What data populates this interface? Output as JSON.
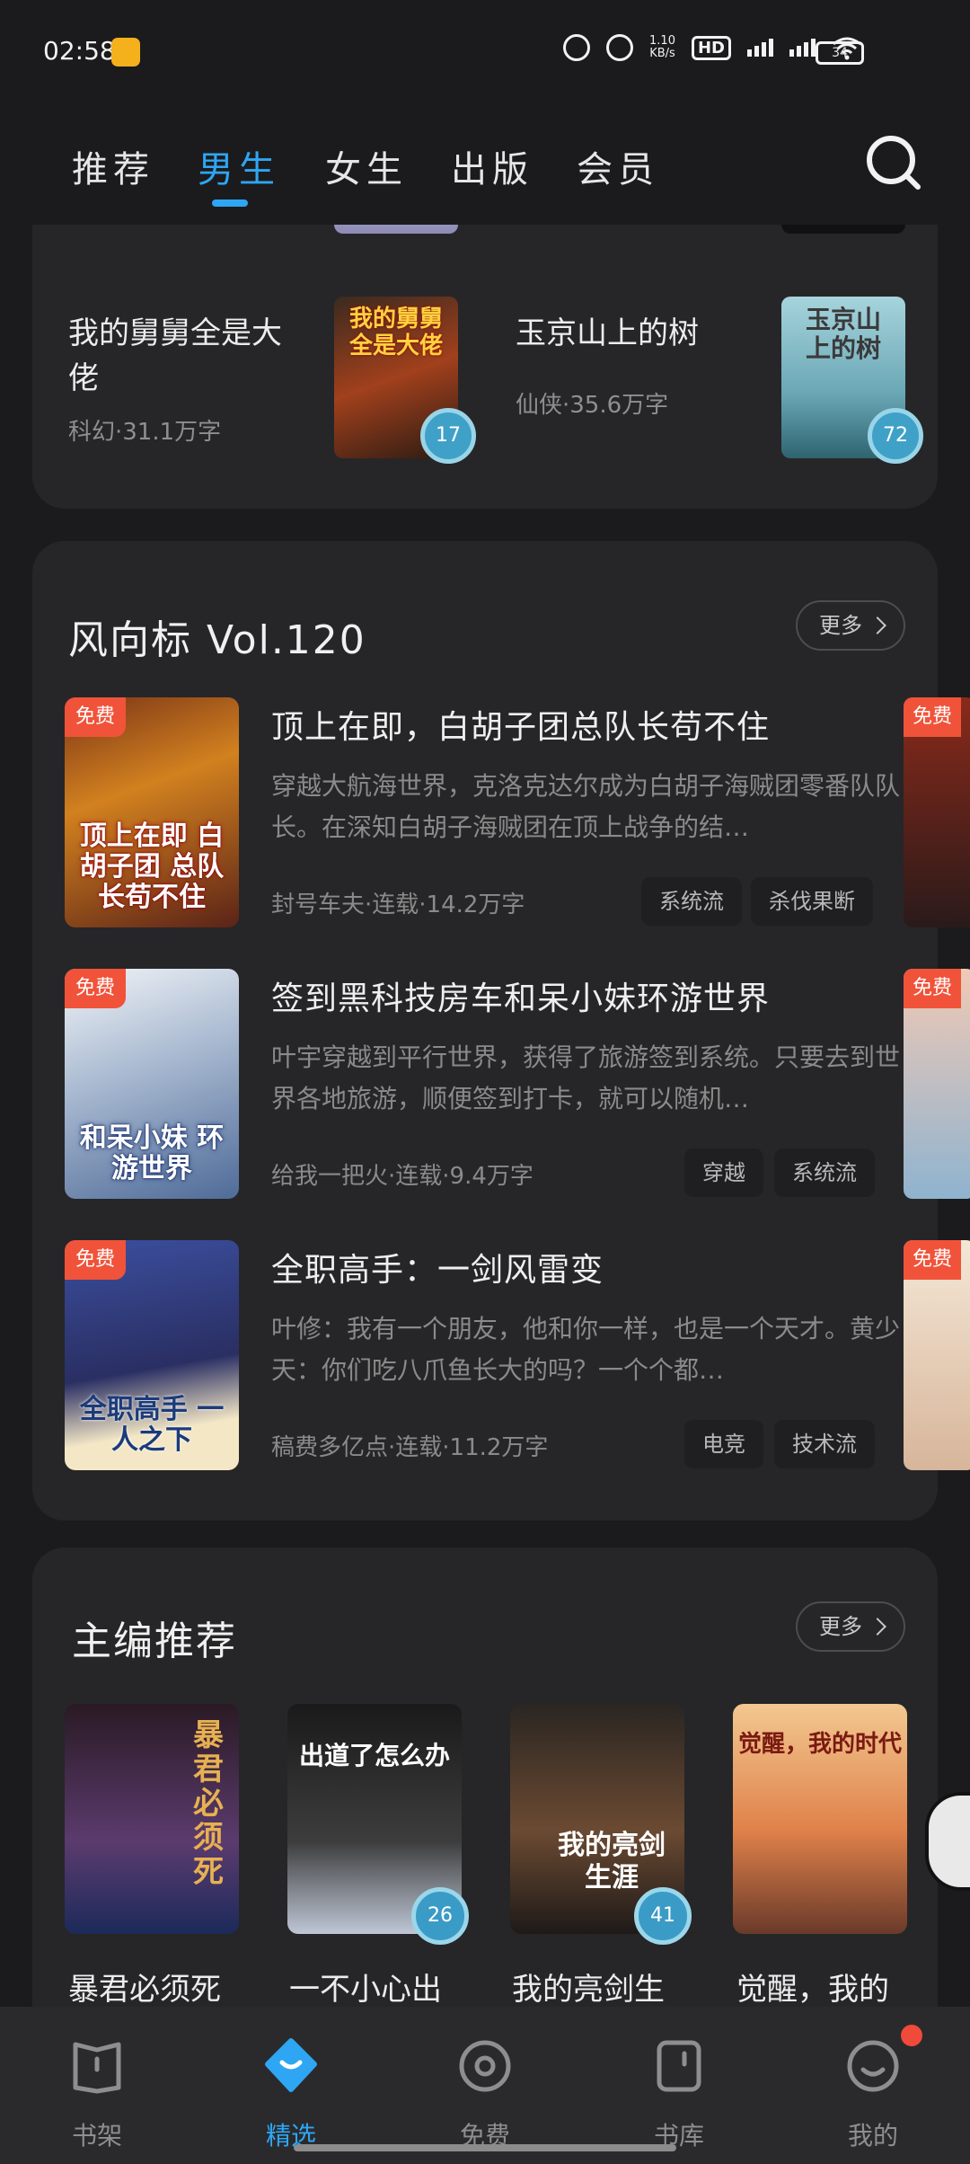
{
  "status": {
    "time": "02:58",
    "net_speed": "1.10\nKB/s",
    "battery": "34"
  },
  "tabs": [
    {
      "label": "推荐"
    },
    {
      "label": "男生"
    },
    {
      "label": "女生"
    },
    {
      "label": "出版"
    },
    {
      "label": "会员"
    }
  ],
  "active_tab": "男生",
  "card1": {
    "books": [
      {
        "title": "我的舅舅全是大佬",
        "meta": "科幻·31.1万字",
        "badge": "17"
      },
      {
        "title": "玉京山上的树",
        "meta": "仙侠·35.6万字",
        "badge": "72"
      }
    ]
  },
  "vane": {
    "title": "风向标 Vol.120",
    "more": "更多",
    "items": [
      {
        "free": "免费",
        "title": "顶上在即，白胡子团总队长苟不住",
        "desc": "穿越大航海世界，克洛克达尔成为白胡子海贼团零番队队长。在深知白胡子海贼团在顶上战争的结…",
        "meta": "封号车夫·连载·14.2万字",
        "tags": [
          "系统流",
          "杀伐果断"
        ],
        "cover_text": "顶上在即 白胡子团 总队长苟不住"
      },
      {
        "free": "免费",
        "title": "签到黑科技房车和呆小妹环游世界",
        "desc": "叶宇穿越到平行世界，获得了旅游签到系统。只要去到世界各地旅游，顺便签到打卡，就可以随机…",
        "meta": "给我一把火·连载·9.4万字",
        "tags": [
          "穿越",
          "系统流"
        ],
        "cover_text": "和呆小妹 环游世界"
      },
      {
        "free": "免费",
        "title": "全职高手：一剑风雷变",
        "desc": "叶修：我有一个朋友，他和你一样，也是一个天才。黄少天：你们吃八爪鱼长大的吗？一个个都…",
        "meta": "稿费多亿点·连载·11.2万字",
        "tags": [
          "电竞",
          "技术流"
        ],
        "cover_text": "全职高手 一人之下"
      }
    ]
  },
  "editor": {
    "title": "主编推荐",
    "more": "更多",
    "books": [
      {
        "title": "暴君必须死",
        "cover_text": "暴君必须死",
        "badge": ""
      },
      {
        "title": "一不小心出",
        "cover_text": "出道了怎么办",
        "badge": "26"
      },
      {
        "title": "我的亮剑生",
        "cover_text": "我的亮剑生涯",
        "badge": "41"
      },
      {
        "title": "觉醒，我的",
        "cover_text": "觉醒，我的时代",
        "badge": ""
      }
    ]
  },
  "bottom_nav": [
    {
      "label": "书架"
    },
    {
      "label": "精选"
    },
    {
      "label": "免费"
    },
    {
      "label": "书库"
    },
    {
      "label": "我的"
    }
  ],
  "colors": {
    "accent": "#2ea6f3",
    "free_tag": "#f0533a",
    "card": "#262628",
    "background": "#1b1b1d"
  }
}
